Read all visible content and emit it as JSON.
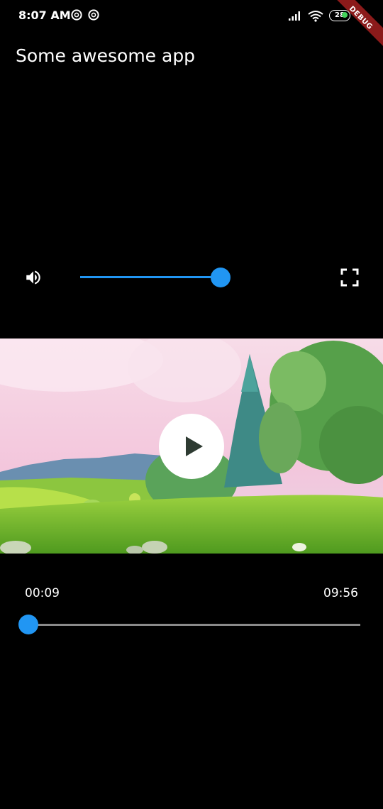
{
  "status_bar": {
    "time": "8:07 AM",
    "notification_icons": [
      "circle-a-icon",
      "circle-a-icon"
    ],
    "signal_icon": "cell-signal-icon",
    "wifi_icon": "wifi-icon",
    "battery_level": "28",
    "charging_icon": "lightning-icon"
  },
  "debug_banner": {
    "label": "DEBUG",
    "color": "#8b1a1a"
  },
  "app_bar": {
    "title": "Some awesome app"
  },
  "volume": {
    "icon": "volume-up-icon",
    "level": 1.0,
    "accent": "#2196f3"
  },
  "fullscreen": {
    "icon": "fullscreen-icon"
  },
  "video": {
    "play_icon": "play-icon"
  },
  "progress": {
    "current_time": "00:09",
    "total_time": "09:56",
    "fraction": 0.015,
    "accent": "#2196f3"
  }
}
